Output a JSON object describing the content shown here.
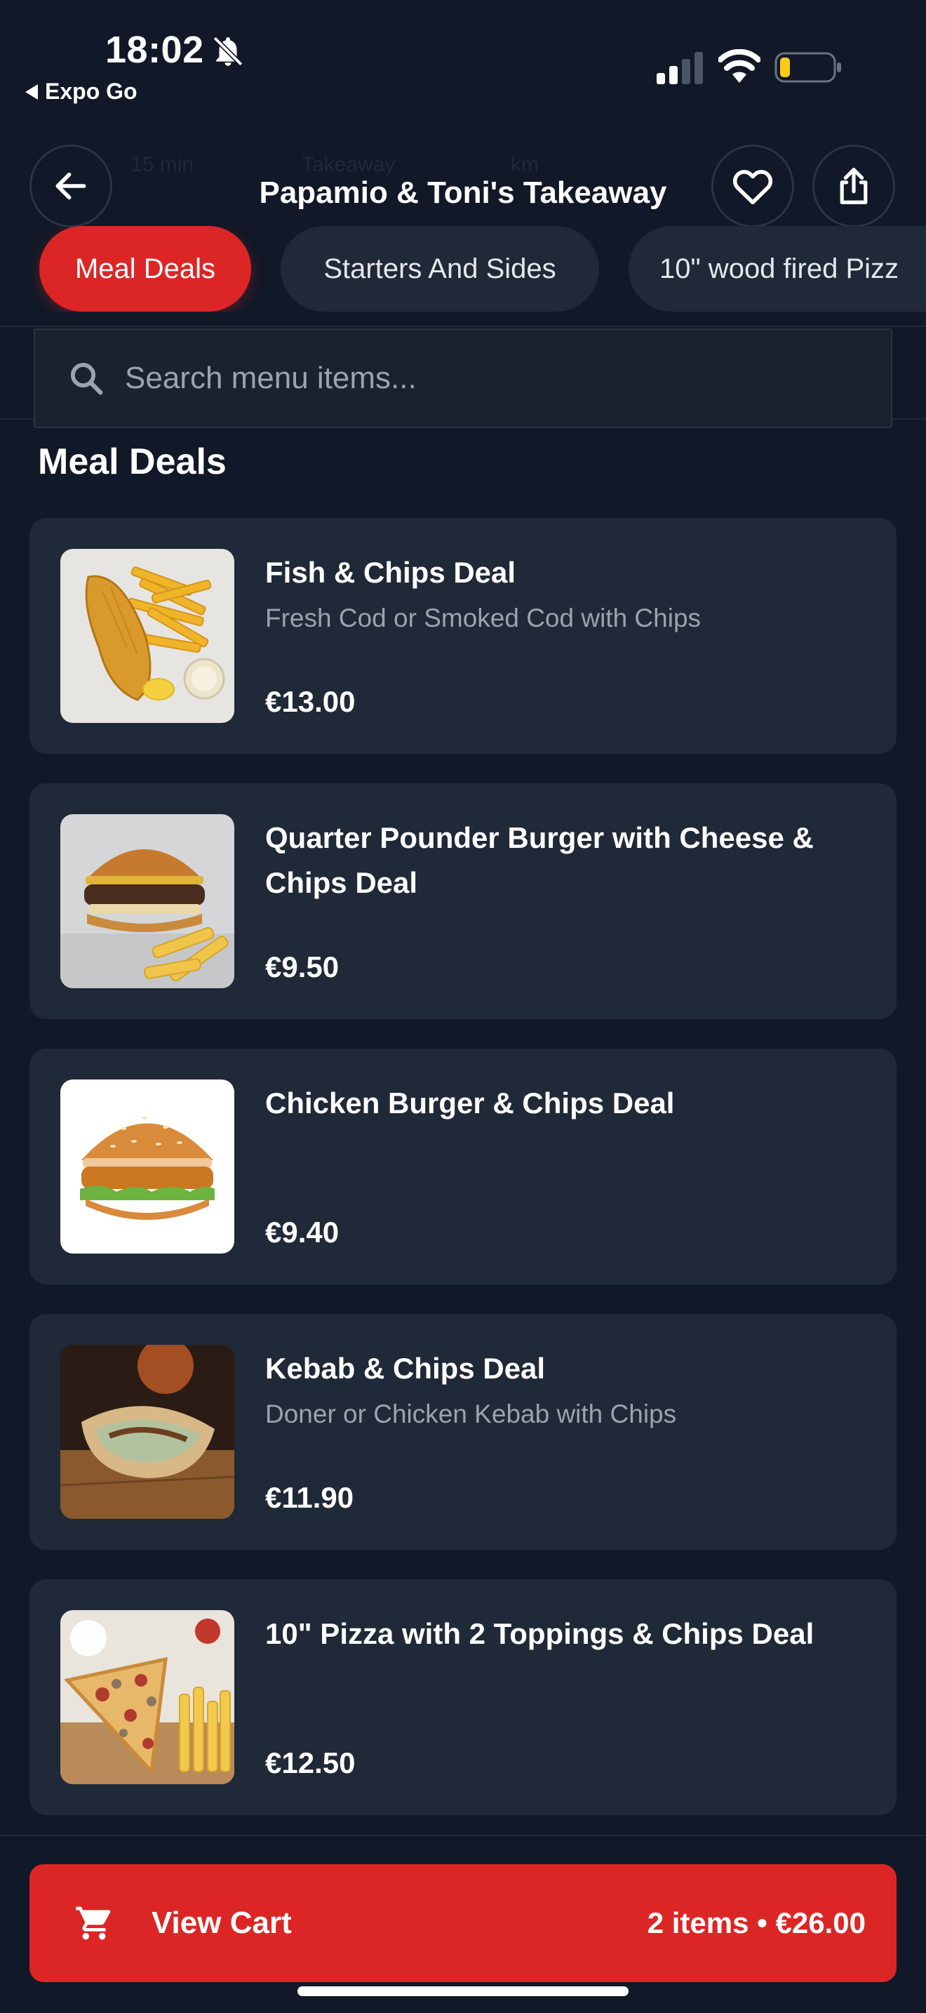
{
  "status_bar": {
    "time": "18:02",
    "back_app_label": "Expo Go",
    "icons": [
      "bell-off-icon",
      "signal-icon",
      "wifi-icon",
      "battery-icon"
    ]
  },
  "header": {
    "title": "Papamio & Toni's Takeaway",
    "ghost_info": [
      "15 min",
      "Takeaway",
      "km"
    ],
    "icons": [
      "arrow-left-icon",
      "heart-icon",
      "share-icon"
    ]
  },
  "category_tabs": [
    {
      "label": "Meal Deals",
      "active": true
    },
    {
      "label": "Starters And Sides",
      "active": false
    },
    {
      "label": "10\" wood fired Pizz",
      "active": false
    }
  ],
  "search": {
    "placeholder": "Search menu items...",
    "value": ""
  },
  "section_title": "Meal Deals",
  "menu_items": [
    {
      "name": "Fish & Chips Deal",
      "description": "Fresh Cod or Smoked Cod with Chips",
      "price": "€13.00",
      "image": "fish-and-chips"
    },
    {
      "name": "Quarter Pounder Burger with Cheese  & Chips Deal",
      "description": "",
      "price": "€9.50",
      "image": "burger-with-chips"
    },
    {
      "name": "Chicken Burger & Chips Deal",
      "description": "",
      "price": "€9.40",
      "image": "chicken-burger"
    },
    {
      "name": "Kebab & Chips Deal",
      "description": "Doner or Chicken Kebab with Chips",
      "price": "€11.90",
      "image": "kebab"
    },
    {
      "name": "10\" Pizza with 2 Toppings & Chips Deal",
      "description": "",
      "price": "€12.50",
      "image": "pizza-slice-with-chips"
    }
  ],
  "cart": {
    "label": "View Cart",
    "summary": "2 items • €26.00"
  },
  "colors": {
    "background": "#111827",
    "card": "#1f2937",
    "accent": "#dc2626",
    "muted_text": "#9ca3af",
    "battery_level": "#facc15"
  }
}
